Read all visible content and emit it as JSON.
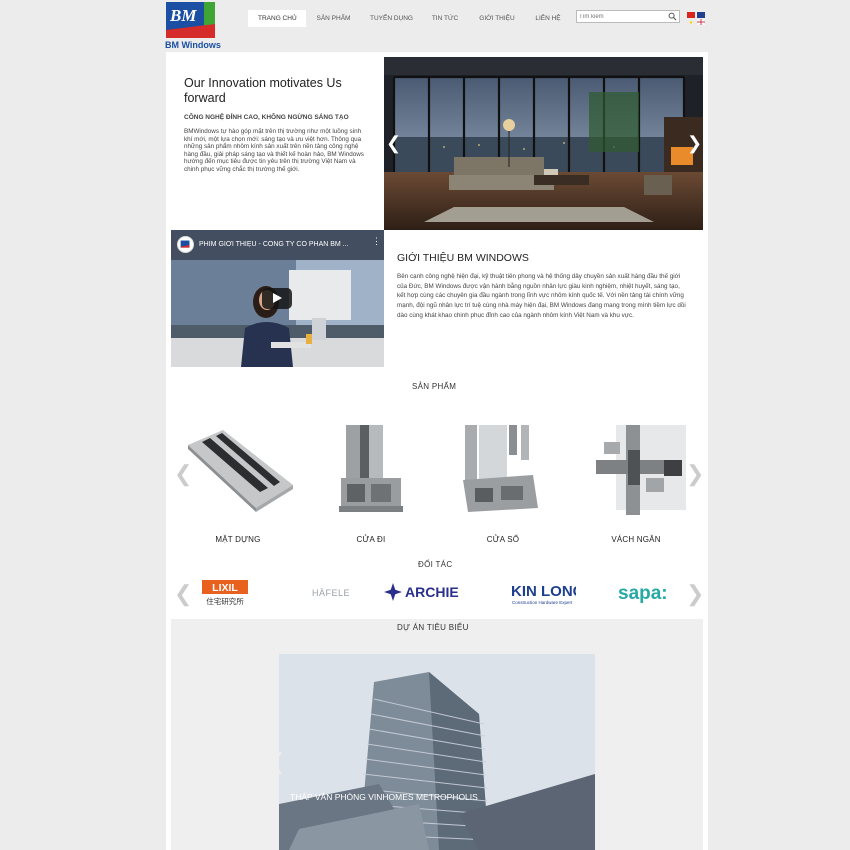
{
  "brand": {
    "logo_letters": "BM",
    "logo_text": "BM Windows"
  },
  "nav": [
    {
      "label": "TRANG CHỦ"
    },
    {
      "label": "SẢN PHẨM"
    },
    {
      "label": "TUYỂN DỤNG"
    },
    {
      "label": "TIN TỨC"
    },
    {
      "label": "GIỚI THIỆU"
    },
    {
      "label": "LIÊN HỆ"
    }
  ],
  "search": {
    "placeholder": "Tìm kiếm"
  },
  "intro": {
    "title": "Our Innovation motivates Us forward",
    "subtitle": "CÔNG NGHỆ ĐỈNH CAO, KHÔNG NGỪNG SÁNG TẠO",
    "text": "BMWindows tự hào góp mặt trên thị trường như một luồng sinh khí mới, một lựa chọn mới: sáng tạo và ưu việt hơn. Thông qua những sản phẩm nhôm kính sản xuất trên nền tảng công nghệ hàng đầu, giải pháp sáng tạo và thiết kế hoàn hảo, BM Windows hướng đến mục tiêu được tin yêu trên thị trường Việt Nam và chinh phục vững chắc thị trường thế giới."
  },
  "video": {
    "title": "PHIM GIỚI THIỆU - CÔNG TY CỔ PHẦN BM ..."
  },
  "about": {
    "title": "GIỚI THIỆU BM WINDOWS",
    "text": "Bên cạnh công nghệ hiện đại, kỹ thuật tiên phong và hệ thống dây chuyền sản xuất hàng đầu thế giới của Đức, BM Windows được vận hành bằng nguồn nhân lực giàu kinh nghiệm, nhiệt huyết, sáng tạo, kết hợp cùng các chuyên gia đầu ngành trong lĩnh vực nhôm kính quốc tế. Với nền tảng tài chính vững mạnh, đội ngũ nhân lực trí tuệ cùng nhà máy hiện đại, BM Windows đang mang trong mình tiềm lực dồi dào cùng khát khao chinh phục đỉnh cao của ngành nhôm kính Việt Nam và khu vực."
  },
  "products": {
    "title": "SẢN PHẨM",
    "items": [
      {
        "label": "MẶT DỰNG"
      },
      {
        "label": "CỬA ĐI"
      },
      {
        "label": "CỬA SỔ"
      },
      {
        "label": "VÁCH NGĂN"
      }
    ]
  },
  "partners": {
    "title": "ĐỐI TÁC",
    "items": [
      {
        "name": "LIXIL",
        "sub": "住宅研究所"
      },
      {
        "name": "HÄFELE"
      },
      {
        "name": "ARCHIE"
      },
      {
        "name": "KIN LONG",
        "sub": "Construction Hardware Expert"
      },
      {
        "name": "sapa:"
      }
    ]
  },
  "projects": {
    "title": "DỰ ÁN TIÊU BIỂU",
    "caption": "THÁP VĂN PHÒNG VINHOMES METROPHOLIS"
  },
  "colors": {
    "brand_blue": "#1a4fa3",
    "brand_red": "#d62b2b",
    "brand_green": "#3fa535"
  }
}
